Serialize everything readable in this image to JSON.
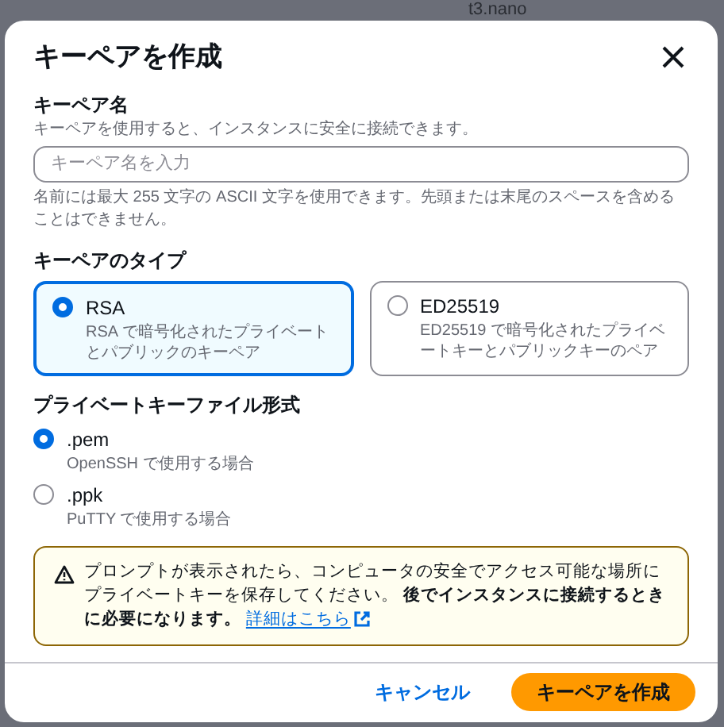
{
  "background": {
    "text": "t3.nano"
  },
  "dialog": {
    "title": "キーペアを作成"
  },
  "name_field": {
    "label": "キーペア名",
    "description": "キーペアを使用すると、インスタンスに安全に接続できます。",
    "placeholder": "キーペア名を入力",
    "hint": "名前には最大 255 文字の ASCII 文字を使用できます。先頭または末尾のスペースを含めることはできません。"
  },
  "key_type": {
    "label": "キーペアのタイプ",
    "options": [
      {
        "title": "RSA",
        "description": "RSA で暗号化されたプライベートとパブリックのキーペア",
        "selected": true
      },
      {
        "title": "ED25519",
        "description": "ED25519 で暗号化されたプライベートキーとパブリックキーのペア",
        "selected": false
      }
    ]
  },
  "file_format": {
    "label": "プライベートキーファイル形式",
    "options": [
      {
        "title": ".pem",
        "description": "OpenSSH で使用する場合",
        "selected": true
      },
      {
        "title": ".ppk",
        "description": "PuTTY で使用する場合",
        "selected": false
      }
    ]
  },
  "warning": {
    "text": "プロンプトが表示されたら、コンピュータの安全でアクセス可能な場所にプライベートキーを保存してください。 **後でインスタンスに接続するときに必要になります。**",
    "link": "詳細はこちら"
  },
  "buttons": [
    {
      "label": "キャンセル",
      "kind": "link"
    },
    {
      "label": "キーペアを作成",
      "kind": "primary"
    }
  ]
}
